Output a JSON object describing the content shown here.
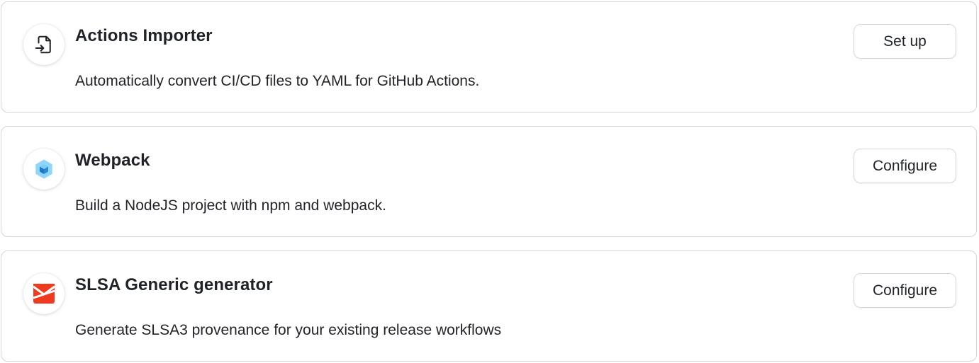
{
  "workflows": [
    {
      "title": "Actions Importer",
      "description": "Automatically convert CI/CD files to YAML for GitHub Actions.",
      "button_label": "Set up",
      "icon": "file-import-icon"
    },
    {
      "title": "Webpack",
      "description": "Build a NodeJS project with npm and webpack.",
      "button_label": "Configure",
      "icon": "webpack-logo-icon",
      "colors": {
        "outer": "#8ed6fb",
        "inner": "#1c78c0"
      }
    },
    {
      "title": "SLSA Generic generator",
      "description": "Generate SLSA3 provenance for your existing release workflows",
      "button_label": "Configure",
      "icon": "slsa-logo-icon",
      "colors": {
        "primary": "#ee3a1d"
      }
    }
  ]
}
